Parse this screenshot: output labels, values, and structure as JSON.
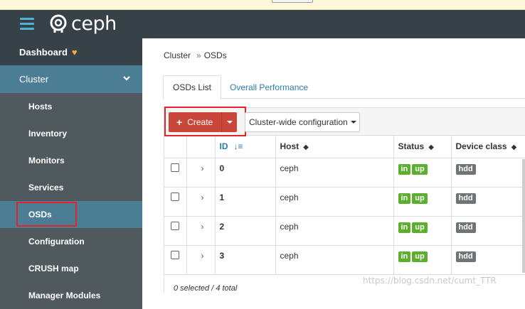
{
  "app": {
    "logo_text": "ceph"
  },
  "sidebar": {
    "dashboard": "Dashboard",
    "cluster": "Cluster",
    "items": [
      {
        "label": "Hosts"
      },
      {
        "label": "Inventory"
      },
      {
        "label": "Monitors"
      },
      {
        "label": "Services"
      },
      {
        "label": "OSDs"
      },
      {
        "label": "Configuration"
      },
      {
        "label": "CRUSH map"
      },
      {
        "label": "Manager Modules"
      }
    ]
  },
  "breadcrumb": {
    "root": "Cluster",
    "sep": "»",
    "current": "OSDs"
  },
  "tabs": [
    {
      "label": "OSDs List"
    },
    {
      "label": "Overall Performance"
    }
  ],
  "toolbar": {
    "create_label": "Create",
    "create_icon": "+",
    "config_label": "Cluster-wide configuration"
  },
  "table": {
    "headers": {
      "id": "ID",
      "host": "Host",
      "status": "Status",
      "device_class": "Device class"
    },
    "rows": [
      {
        "id": "0",
        "host": "ceph",
        "status": [
          "in",
          "up"
        ],
        "device_class": "hdd"
      },
      {
        "id": "1",
        "host": "ceph",
        "status": [
          "in",
          "up"
        ],
        "device_class": "hdd"
      },
      {
        "id": "2",
        "host": "ceph",
        "status": [
          "in",
          "up"
        ],
        "device_class": "hdd"
      },
      {
        "id": "3",
        "host": "ceph",
        "status": [
          "in",
          "up"
        ],
        "device_class": "hdd"
      }
    ],
    "footer": "0 selected / 4 total"
  },
  "watermark": "https://blog.csdn.net/cumt_TTR",
  "colors": {
    "accent": "#4b7e94",
    "create": "#c9463a",
    "badge_green": "#5cae2f",
    "badge_grey": "#6f7576",
    "highlight": "#e2252b"
  }
}
